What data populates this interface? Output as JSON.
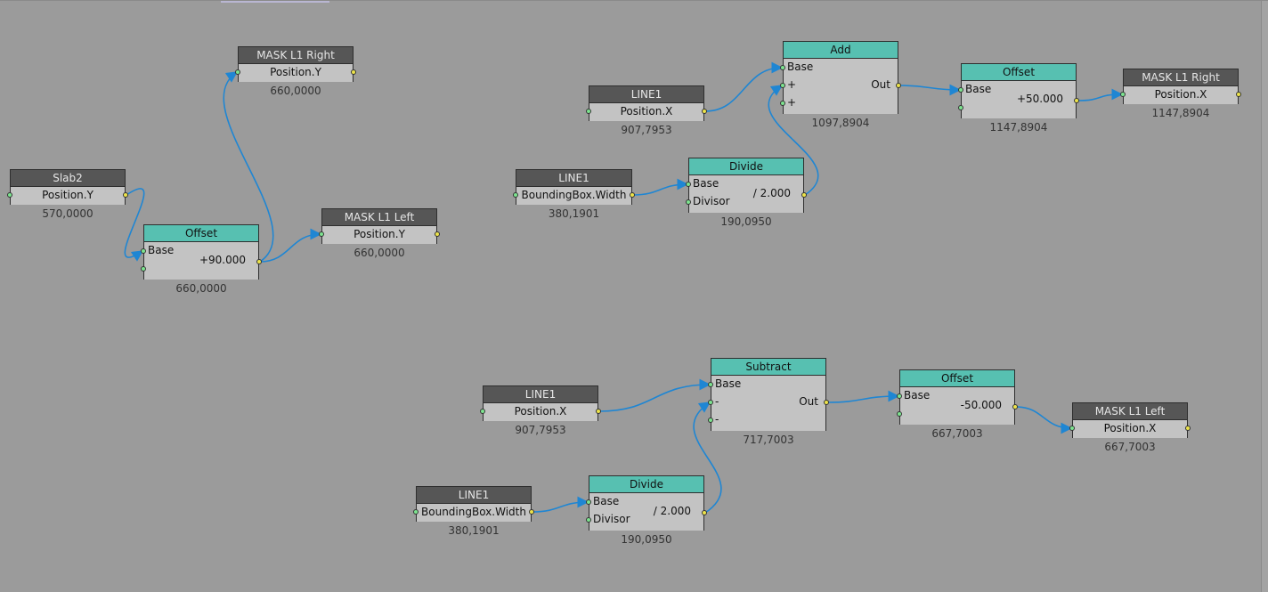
{
  "editor": {
    "nodes": [
      {
        "id": "slab2",
        "kind": "attr",
        "title": "Slab2",
        "attribute": "Position.Y",
        "value": "570,0000"
      },
      {
        "id": "offset_a",
        "kind": "math",
        "title": "Offset",
        "ports": [
          "Base",
          ""
        ],
        "operand": "+90.000",
        "value": "660,0000"
      },
      {
        "id": "mask_right_y",
        "kind": "attr",
        "title": "MASK L1 Right",
        "attribute": "Position.Y",
        "value": "660,0000"
      },
      {
        "id": "mask_left_y",
        "kind": "attr",
        "title": "MASK L1 Left",
        "attribute": "Position.Y",
        "value": "660,0000"
      },
      {
        "id": "line1_x_a",
        "kind": "attr",
        "title": "LINE1",
        "attribute": "Position.X",
        "value": "907,7953"
      },
      {
        "id": "line1_bb_a",
        "kind": "attr",
        "title": "LINE1",
        "attribute": "BoundingBox.Width",
        "value": "380,1901"
      },
      {
        "id": "divide_a",
        "kind": "math",
        "title": "Divide",
        "ports": [
          "Base",
          "Divisor"
        ],
        "operand": "/ 2.000",
        "value": "190,0950"
      },
      {
        "id": "add",
        "kind": "math",
        "title": "Add",
        "ports": [
          "Base",
          "+",
          "+"
        ],
        "out_label": "Out",
        "operand": "",
        "value": "1097,8904"
      },
      {
        "id": "offset_b",
        "kind": "math",
        "title": "Offset",
        "ports": [
          "Base",
          ""
        ],
        "operand": "+50.000",
        "value": "1147,8904"
      },
      {
        "id": "mask_right_x",
        "kind": "attr",
        "title": "MASK L1 Right",
        "attribute": "Position.X",
        "value": "1147,8904"
      },
      {
        "id": "line1_x_b",
        "kind": "attr",
        "title": "LINE1",
        "attribute": "Position.X",
        "value": "907,7953"
      },
      {
        "id": "line1_bb_b",
        "kind": "attr",
        "title": "LINE1",
        "attribute": "BoundingBox.Width",
        "value": "380,1901"
      },
      {
        "id": "divide_b",
        "kind": "math",
        "title": "Divide",
        "ports": [
          "Base",
          "Divisor"
        ],
        "operand": "/ 2.000",
        "value": "190,0950"
      },
      {
        "id": "subtract",
        "kind": "math",
        "title": "Subtract",
        "ports": [
          "Base",
          "-",
          "-"
        ],
        "out_label": "Out",
        "operand": "",
        "value": "717,7003"
      },
      {
        "id": "offset_c",
        "kind": "math",
        "title": "Offset",
        "ports": [
          "Base",
          ""
        ],
        "operand": "-50.000",
        "value": "667,7003"
      },
      {
        "id": "mask_left_x",
        "kind": "attr",
        "title": "MASK L1 Left",
        "attribute": "Position.X",
        "value": "667,7003"
      }
    ],
    "connections": [
      [
        "slab2",
        "offset_a.Base"
      ],
      [
        "offset_a",
        "mask_right_y"
      ],
      [
        "offset_a",
        "mask_left_y"
      ],
      [
        "line1_x_a",
        "add.Base"
      ],
      [
        "line1_bb_a",
        "divide_a.Base"
      ],
      [
        "divide_a",
        "add.+"
      ],
      [
        "add",
        "offset_b.Base"
      ],
      [
        "offset_b",
        "mask_right_x"
      ],
      [
        "line1_x_b",
        "subtract.Base"
      ],
      [
        "line1_bb_b",
        "divide_b.Base"
      ],
      [
        "divide_b",
        "subtract.-"
      ],
      [
        "subtract",
        "offset_c.Base"
      ],
      [
        "offset_c",
        "mask_left_x"
      ]
    ],
    "colors": {
      "canvas": "#9b9b9b",
      "attr_header": "#565656",
      "math_header": "#57c0b1",
      "node_body": "#c3c3c3",
      "wire": "#1f86d3",
      "input_port": "#7de38f",
      "output_port": "#ece34b"
    }
  }
}
